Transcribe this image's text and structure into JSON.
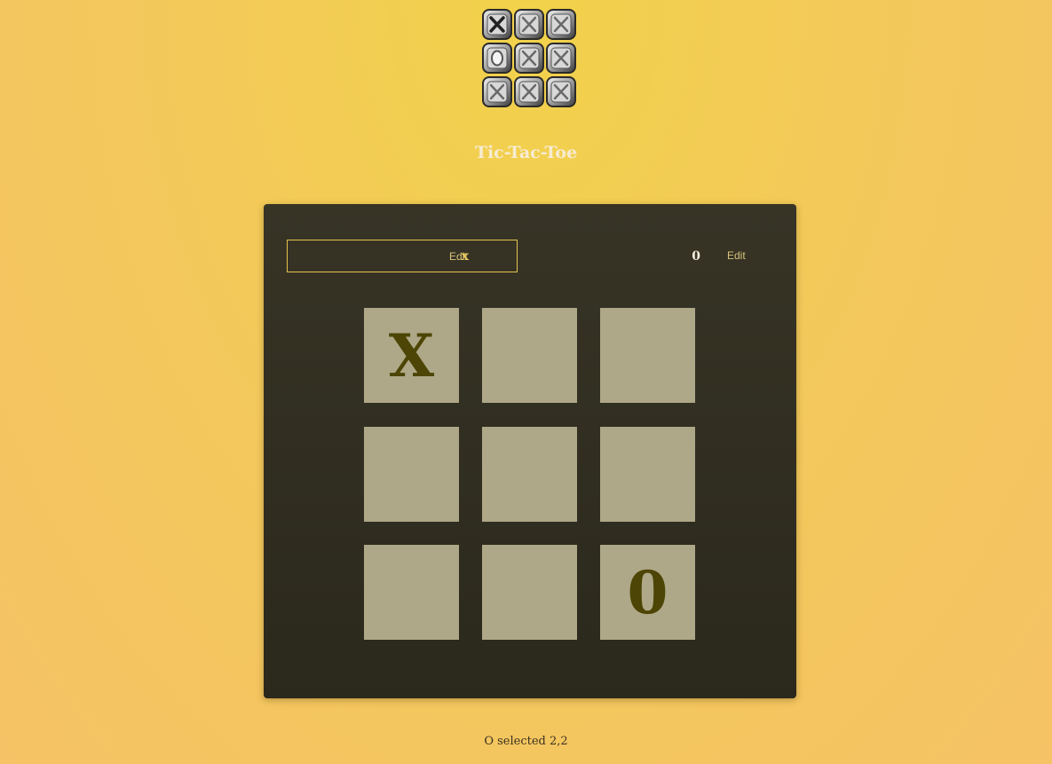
{
  "header": {
    "logo_icon": "tic-tac-toe-logo-icon",
    "title": "Tic-Tac-Toe"
  },
  "players": [
    {
      "mark": "x",
      "edit_label": "Edit",
      "active": true
    },
    {
      "mark": "0",
      "edit_label": "Edit",
      "active": false
    }
  ],
  "board": {
    "cells": [
      [
        "X",
        "",
        ""
      ],
      [
        "",
        "",
        ""
      ],
      [
        "",
        "",
        "0"
      ]
    ]
  },
  "status": "O selected 2,2",
  "colors": {
    "accent": "#f1c94a",
    "cell_bg": "#aea888",
    "mark_color": "#4c4505",
    "panel_bg": "#312e21"
  }
}
